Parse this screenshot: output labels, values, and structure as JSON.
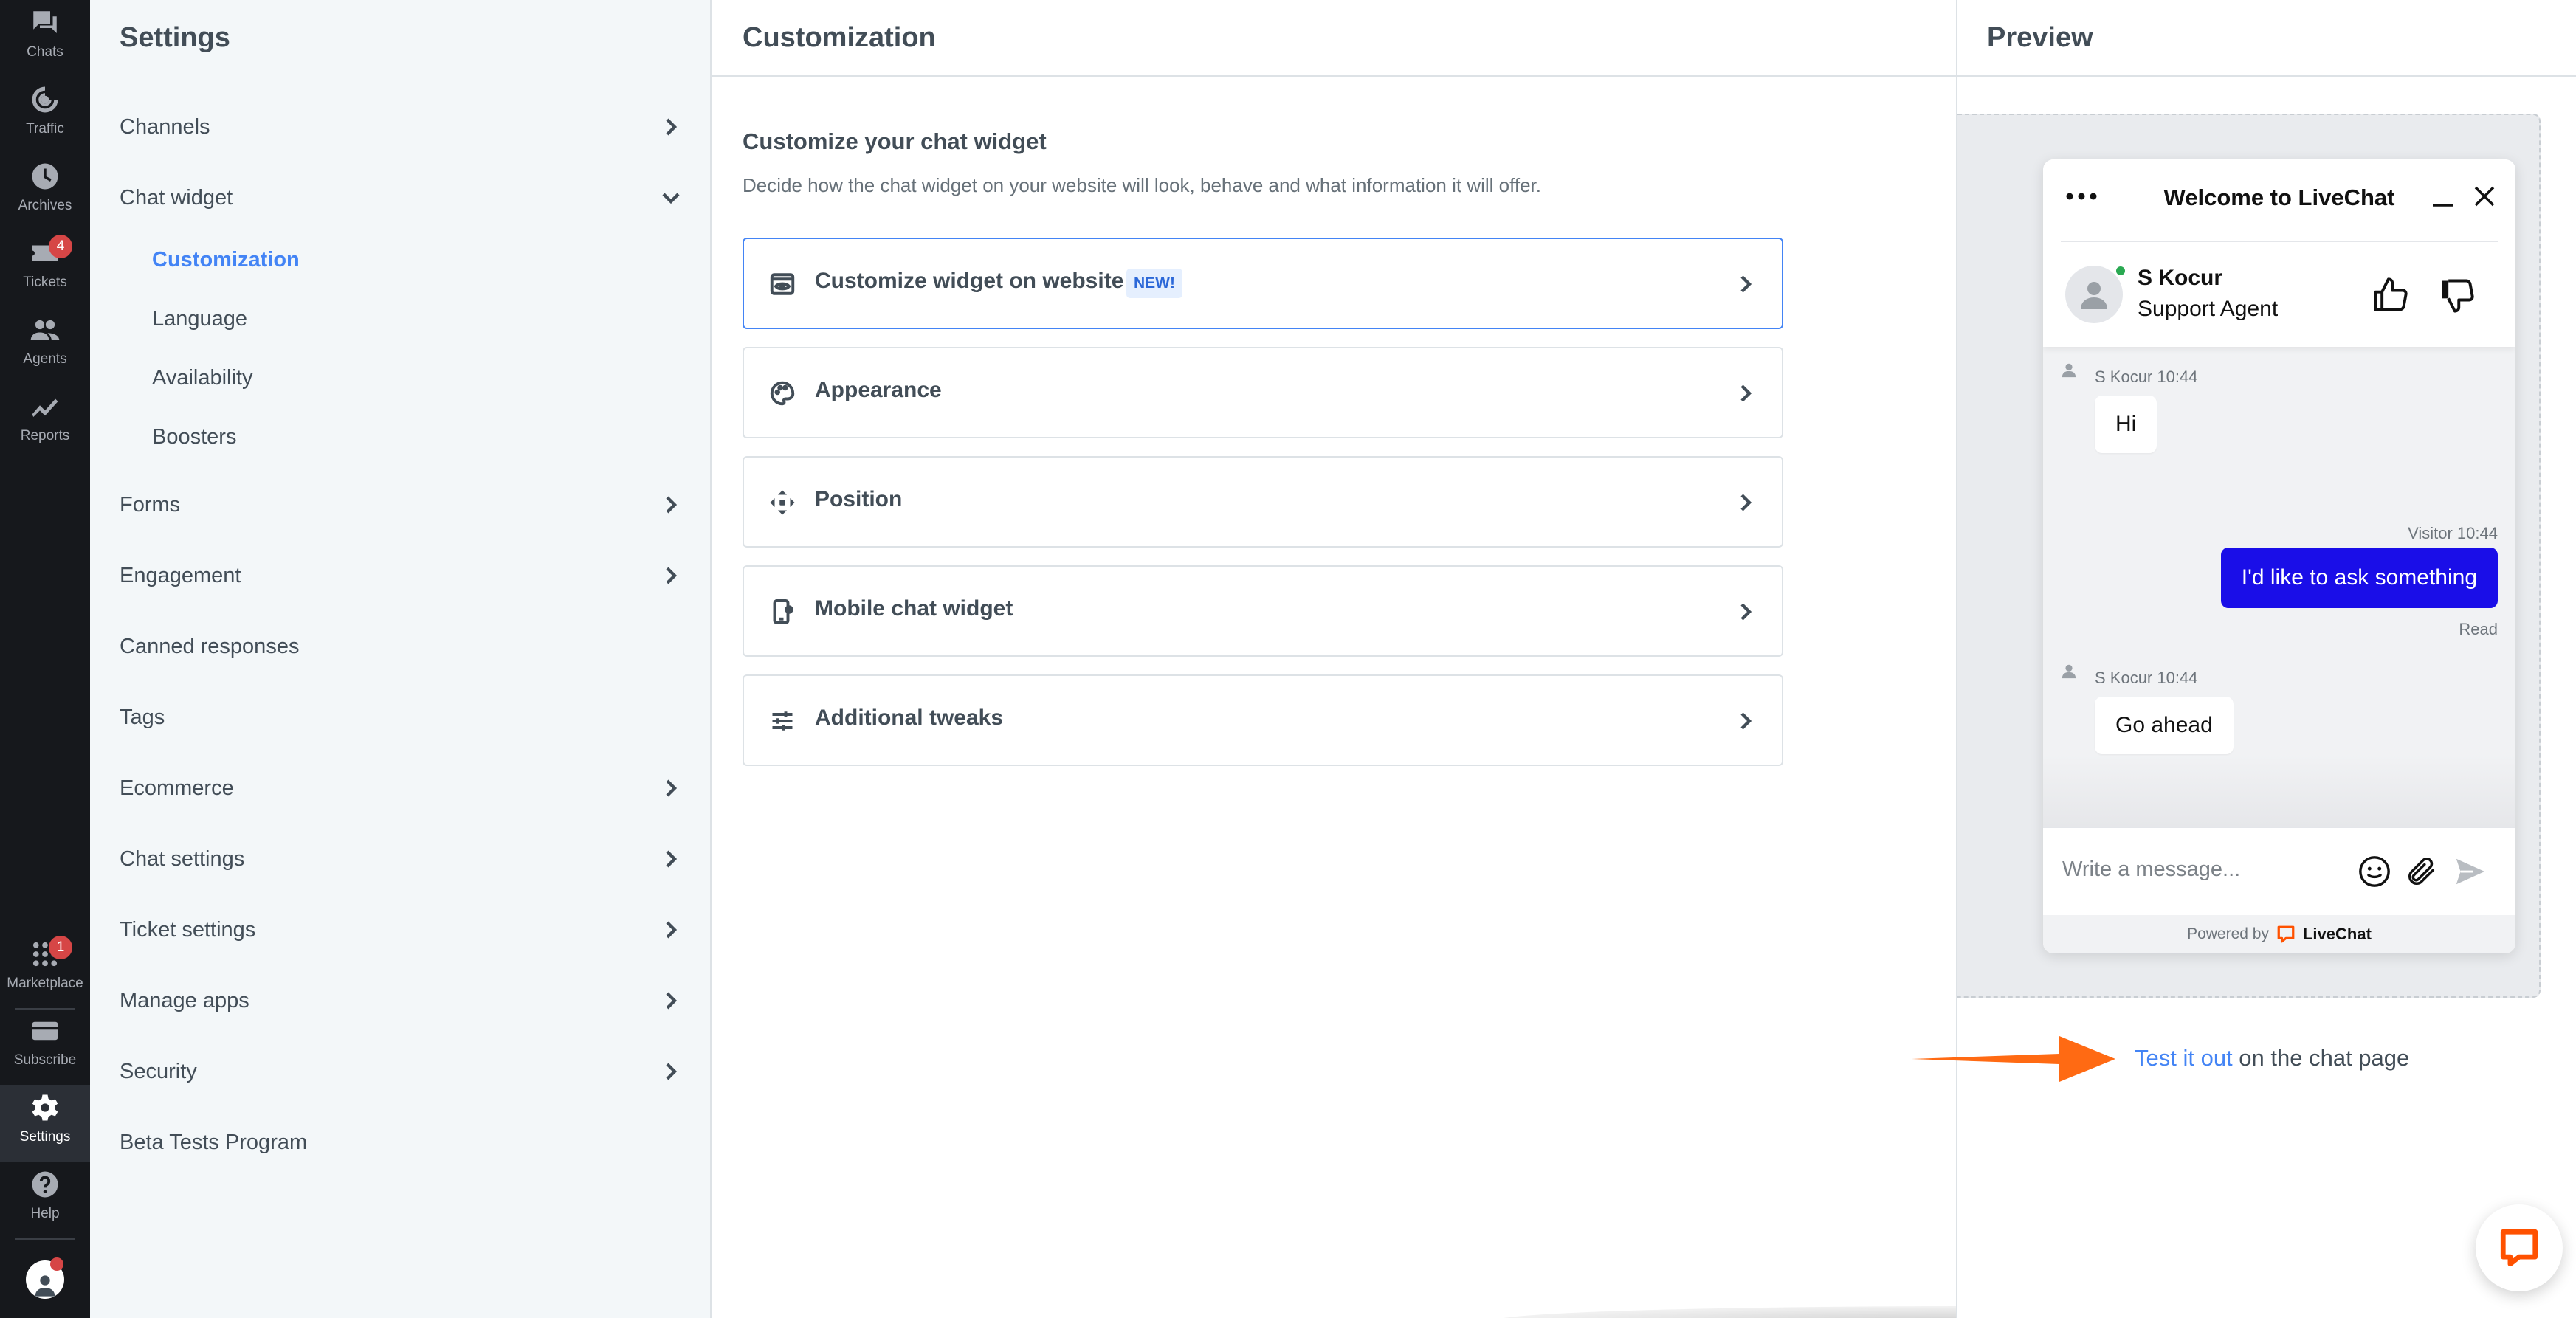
{
  "rail": {
    "items": [
      {
        "label": "Chats",
        "icon": "chats-icon"
      },
      {
        "label": "Traffic",
        "icon": "traffic-icon"
      },
      {
        "label": "Archives",
        "icon": "archives-icon"
      },
      {
        "label": "Tickets",
        "icon": "tickets-icon",
        "badge": "4"
      },
      {
        "label": "Agents",
        "icon": "agents-icon"
      },
      {
        "label": "Reports",
        "icon": "reports-icon"
      },
      {
        "label": "Marketplace",
        "icon": "marketplace-icon",
        "badge": "1"
      },
      {
        "label": "Subscribe",
        "icon": "subscribe-icon"
      },
      {
        "label": "Settings",
        "icon": "settings-icon",
        "active": true
      },
      {
        "label": "Help",
        "icon": "help-icon"
      }
    ]
  },
  "settings_nav": {
    "title": "Settings",
    "items": [
      {
        "label": "Channels",
        "chevron": "right"
      },
      {
        "label": "Chat widget",
        "chevron": "down"
      },
      {
        "label": "Forms",
        "chevron": "right"
      },
      {
        "label": "Engagement",
        "chevron": "right"
      },
      {
        "label": "Canned responses"
      },
      {
        "label": "Tags"
      },
      {
        "label": "Ecommerce",
        "chevron": "right"
      },
      {
        "label": "Chat settings",
        "chevron": "right"
      },
      {
        "label": "Ticket settings",
        "chevron": "right"
      },
      {
        "label": "Manage apps",
        "chevron": "right"
      },
      {
        "label": "Security",
        "chevron": "right"
      },
      {
        "label": "Beta Tests Program"
      }
    ],
    "chat_widget_sub": [
      {
        "label": "Customization",
        "active": true
      },
      {
        "label": "Language"
      },
      {
        "label": "Availability"
      },
      {
        "label": "Boosters"
      }
    ]
  },
  "customization": {
    "title": "Customization",
    "heading": "Customize your chat widget",
    "description": "Decide how the chat widget on your website will look, behave and what information it will offer.",
    "options": [
      {
        "label": "Customize widget on website",
        "badge": "NEW!",
        "icon": "eye-window-icon",
        "selected": true
      },
      {
        "label": "Appearance",
        "icon": "palette-icon"
      },
      {
        "label": "Position",
        "icon": "move-arrows-icon"
      },
      {
        "label": "Mobile chat widget",
        "icon": "mobile-icon"
      },
      {
        "label": "Additional tweaks",
        "icon": "sliders-icon"
      }
    ]
  },
  "preview": {
    "title": "Preview",
    "widget": {
      "title": "Welcome to LiveChat",
      "agent_name": "S Kocur",
      "agent_role": "Support Agent",
      "messages": [
        {
          "from": "agent",
          "meta": "S Kocur 10:44",
          "text": "Hi"
        },
        {
          "from": "visitor",
          "meta": "Visitor 10:44",
          "text": "I'd like to ask something",
          "status": "Read"
        },
        {
          "from": "agent",
          "meta": "S Kocur 10:44",
          "text": "Go ahead"
        }
      ],
      "input_placeholder": "Write a message...",
      "powered_by": "Powered by",
      "brand": "LiveChat"
    },
    "test_link": "Test it out",
    "test_suffix": " on the chat page"
  },
  "colors": {
    "accent": "#4384f5",
    "visitor_bubble": "#1a0ee8",
    "rail_bg": "#16181c",
    "badge": "#d64646",
    "arrow": "#ff6a13",
    "brand": "#ff5100"
  }
}
